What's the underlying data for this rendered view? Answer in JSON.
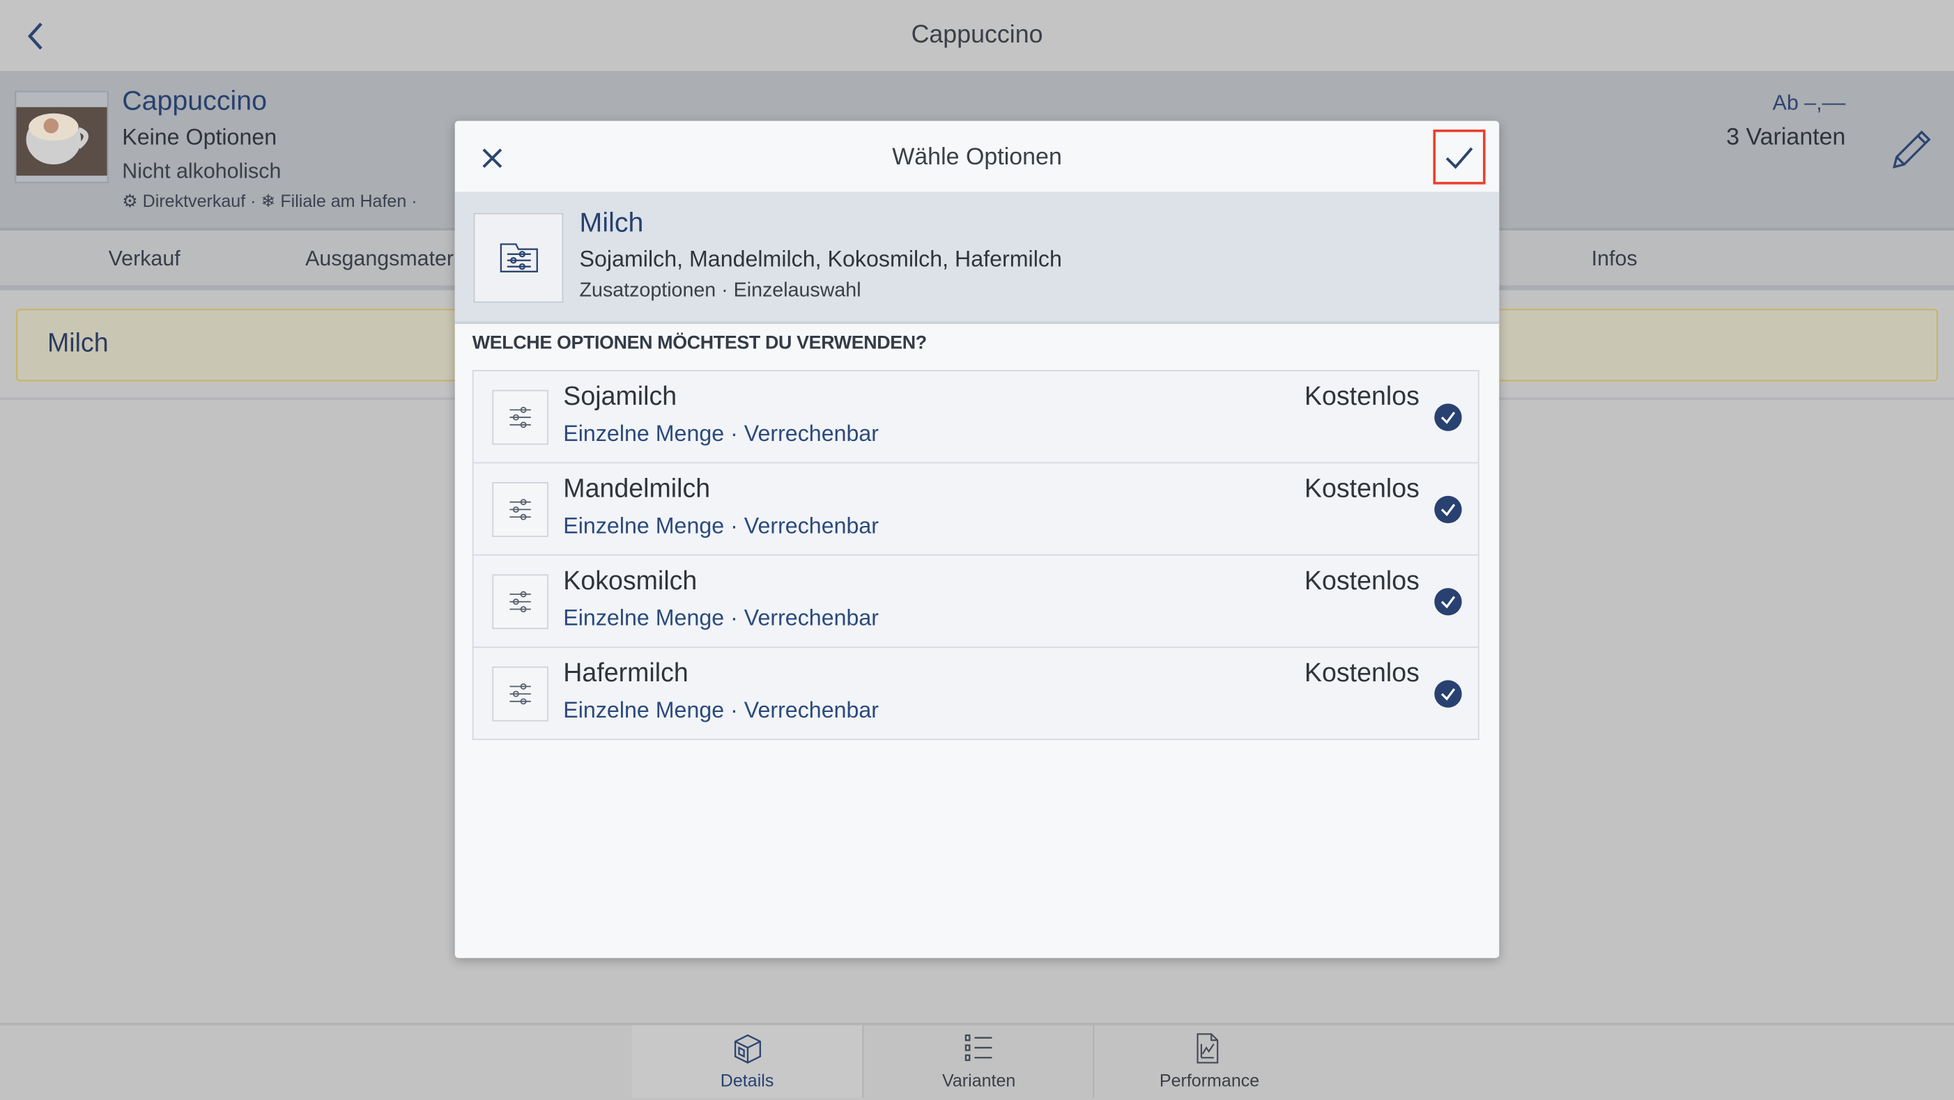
{
  "topbar": {
    "title": "Cappuccino",
    "back_icon": "chevron-left-icon"
  },
  "product": {
    "name": "Cappuccino",
    "options": "Keine Optionen",
    "category": "Nicht alkoholisch",
    "meta": [
      "Direktverkauf",
      "Filiale am Hafen"
    ],
    "price": "Ab –,––",
    "variants": "3 Varianten"
  },
  "tabs": [
    "Verkauf",
    "Ausgangsmateri",
    "Infos"
  ],
  "selected_group": "Milch",
  "bottom_tabs": [
    {
      "label": "Details",
      "icon": "box-icon",
      "active": true
    },
    {
      "label": "Varianten",
      "icon": "list-icon"
    },
    {
      "label": "Performance",
      "icon": "chart-document-icon"
    }
  ],
  "modal": {
    "title": "Wähle Optionen",
    "group": {
      "name": "Milch",
      "options": "Sojamilch, Mandelmilch, Kokosmilch, Hafermilch",
      "meta": "Zusatzoptionen · Einzelauswahl"
    },
    "question": "WELCHE OPTIONEN MÖCHTEST DU VERWENDEN?",
    "items": [
      {
        "name": "Sojamilch",
        "sub": "Einzelne Menge · Verrechenbar",
        "price": "Kostenlos",
        "selected": true
      },
      {
        "name": "Mandelmilch",
        "sub": "Einzelne Menge · Verrechenbar",
        "price": "Kostenlos",
        "selected": true
      },
      {
        "name": "Kokosmilch",
        "sub": "Einzelne Menge · Verrechenbar",
        "price": "Kostenlos",
        "selected": true
      },
      {
        "name": "Hafermilch",
        "sub": "Einzelne Menge · Verrechenbar",
        "price": "Kostenlos",
        "selected": true
      }
    ]
  },
  "colors": {
    "accent": "#26416f",
    "highlight": "#e8412e",
    "check": "#284170"
  }
}
